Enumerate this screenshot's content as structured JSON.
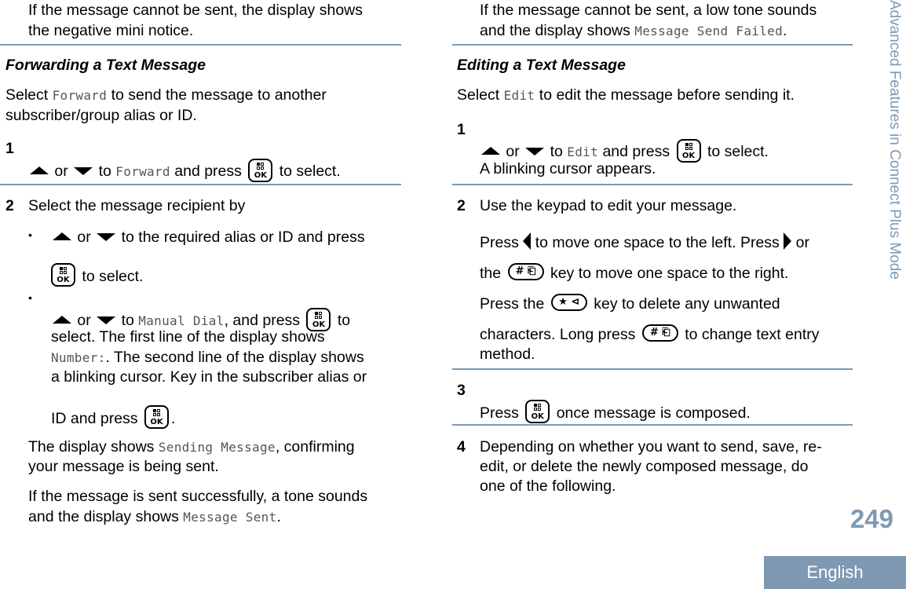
{
  "left": {
    "intro_line1": "If the message cannot be sent, the display shows",
    "intro_line2": "the negative mini notice.",
    "heading": "Forwarding a Text Message",
    "desc_pre": "Select ",
    "desc_mono": "Forward",
    "desc_post": " to send the message to another",
    "desc_line2": "subscriber/group alias or ID.",
    "step1": {
      "num": "1",
      "or": "or",
      "to": "to",
      "mono": "Forward",
      "and_press": "and press",
      "to_select": "to select."
    },
    "step2": {
      "num": "2",
      "text": "Select the message recipient by",
      "bullet1": {
        "or": "or",
        "text": "to the required alias or ID and press",
        "to_select": "to select."
      },
      "bullet2": {
        "or": "or",
        "to": "to",
        "mono": "Manual Dial",
        "and_press": ", and press",
        "line2": "select. The first line of the display shows",
        "line3_mono": "Number:",
        "line3_post": ". The second line of the display shows",
        "line4": "a blinking cursor. Key in the subscriber alias or",
        "line5": "ID and press",
        "line5_end": "."
      },
      "result1_pre": "The display shows ",
      "result1_mono": "Sending Message",
      "result1_post": ", confirming",
      "result1_line2": "your message is being sent.",
      "result2_line1": "If the message is sent successfully, a tone sounds",
      "result2_pre": "and the display shows ",
      "result2_mono": "Message Sent",
      "result2_post": "."
    }
  },
  "right": {
    "intro_line1": "If the message cannot be sent, a low tone sounds",
    "intro_pre": "and the display shows ",
    "intro_mono": "Message Send Failed",
    "intro_post": ".",
    "heading": "Editing a Text Message",
    "desc_pre": "Select ",
    "desc_mono": "Edit",
    "desc_post": " to edit the message before sending it.",
    "step1": {
      "num": "1",
      "or": "or",
      "to": "to",
      "mono": "Edit",
      "and_press": "and press",
      "to_select": "to select.",
      "line2": "A blinking cursor appears."
    },
    "step2": {
      "num": "2",
      "text": "Use the keypad to edit your message.",
      "l1_a": "Press",
      "l1_b": "to move one space to the left. Press",
      "l1_c": "or",
      "l2_a": "the",
      "l2_b": "key to move one space to the right.",
      "l3_a": "Press the",
      "l3_b": "key to delete any unwanted",
      "l4_a": "characters. Long press",
      "l4_b": "to change text entry",
      "l5": "method."
    },
    "step3": {
      "num": "3",
      "pre": "Press",
      "post": "once message is composed."
    },
    "step4": {
      "num": "4",
      "line1": "Depending on whether you want to send, save, re-",
      "line2": "edit, or delete the newly composed message, do",
      "line3": "one of the following."
    }
  },
  "keys": {
    "ok_label": "OK",
    "hash_label": "# ⎗",
    "star_label": "★ ⊲"
  },
  "sidebar_title": "Advanced Features in Connect Plus Mode",
  "page_number": "249",
  "language_tab": "English",
  "accent_color": "#7f99b2"
}
